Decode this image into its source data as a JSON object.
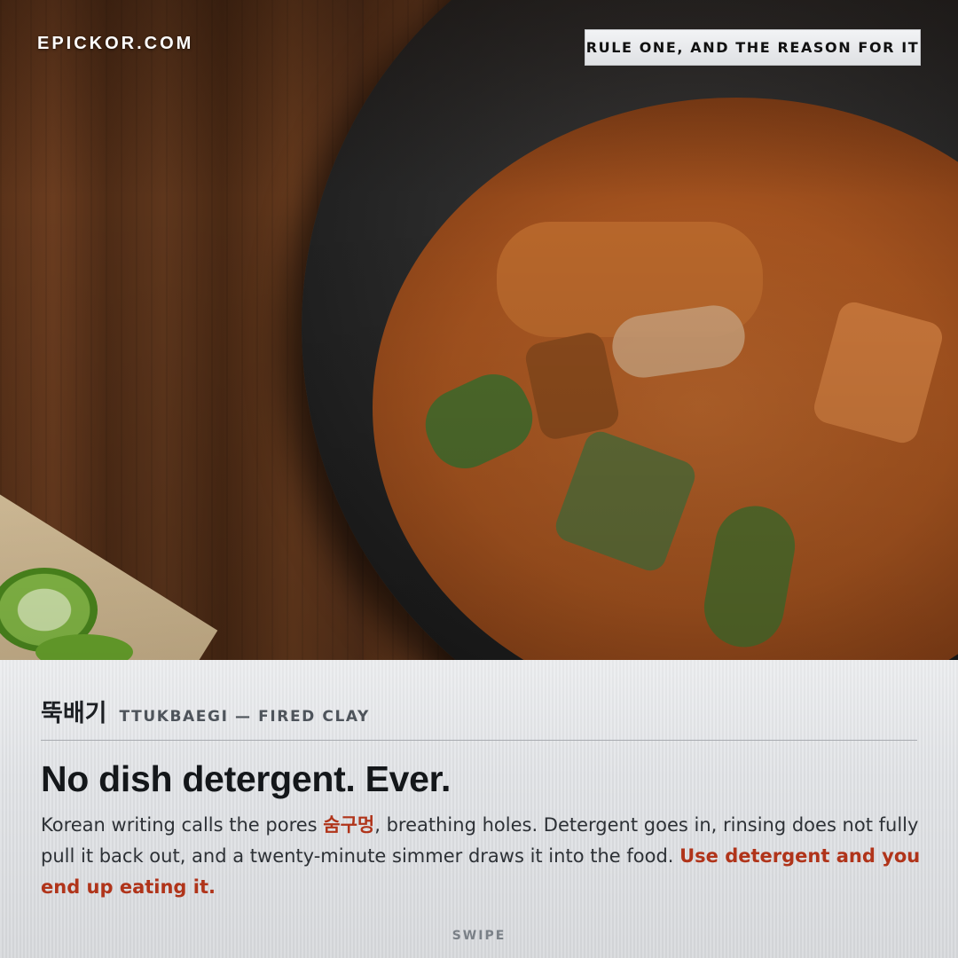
{
  "brand": {
    "name": "EPICKOR.COM"
  },
  "header_tag": {
    "label": "RULE ONE, AND THE REASON FOR IT"
  },
  "caption": {
    "korean": "뚝배기",
    "romanized": "TTUKBAEGI — FIRED CLAY",
    "headline": "No dish detergent. Ever.",
    "body": {
      "part1": "Korean writing calls the pores ",
      "korean_term": "숨구멍",
      "part2": ", breathing holes. Detergent goes in, rinsing does not fully pull it back out, and a twenty-minute simmer draws it into the food. ",
      "emphasis": "Use detergent and you end up eating it."
    },
    "swipe_label": "SWIPE"
  },
  "colors": {
    "accent": "#b0341a",
    "headline": "#14171a",
    "panel_bg": "#e4e6e9"
  },
  "icons": {
    "background_photo": "stew-in-clay-pot-photo"
  }
}
